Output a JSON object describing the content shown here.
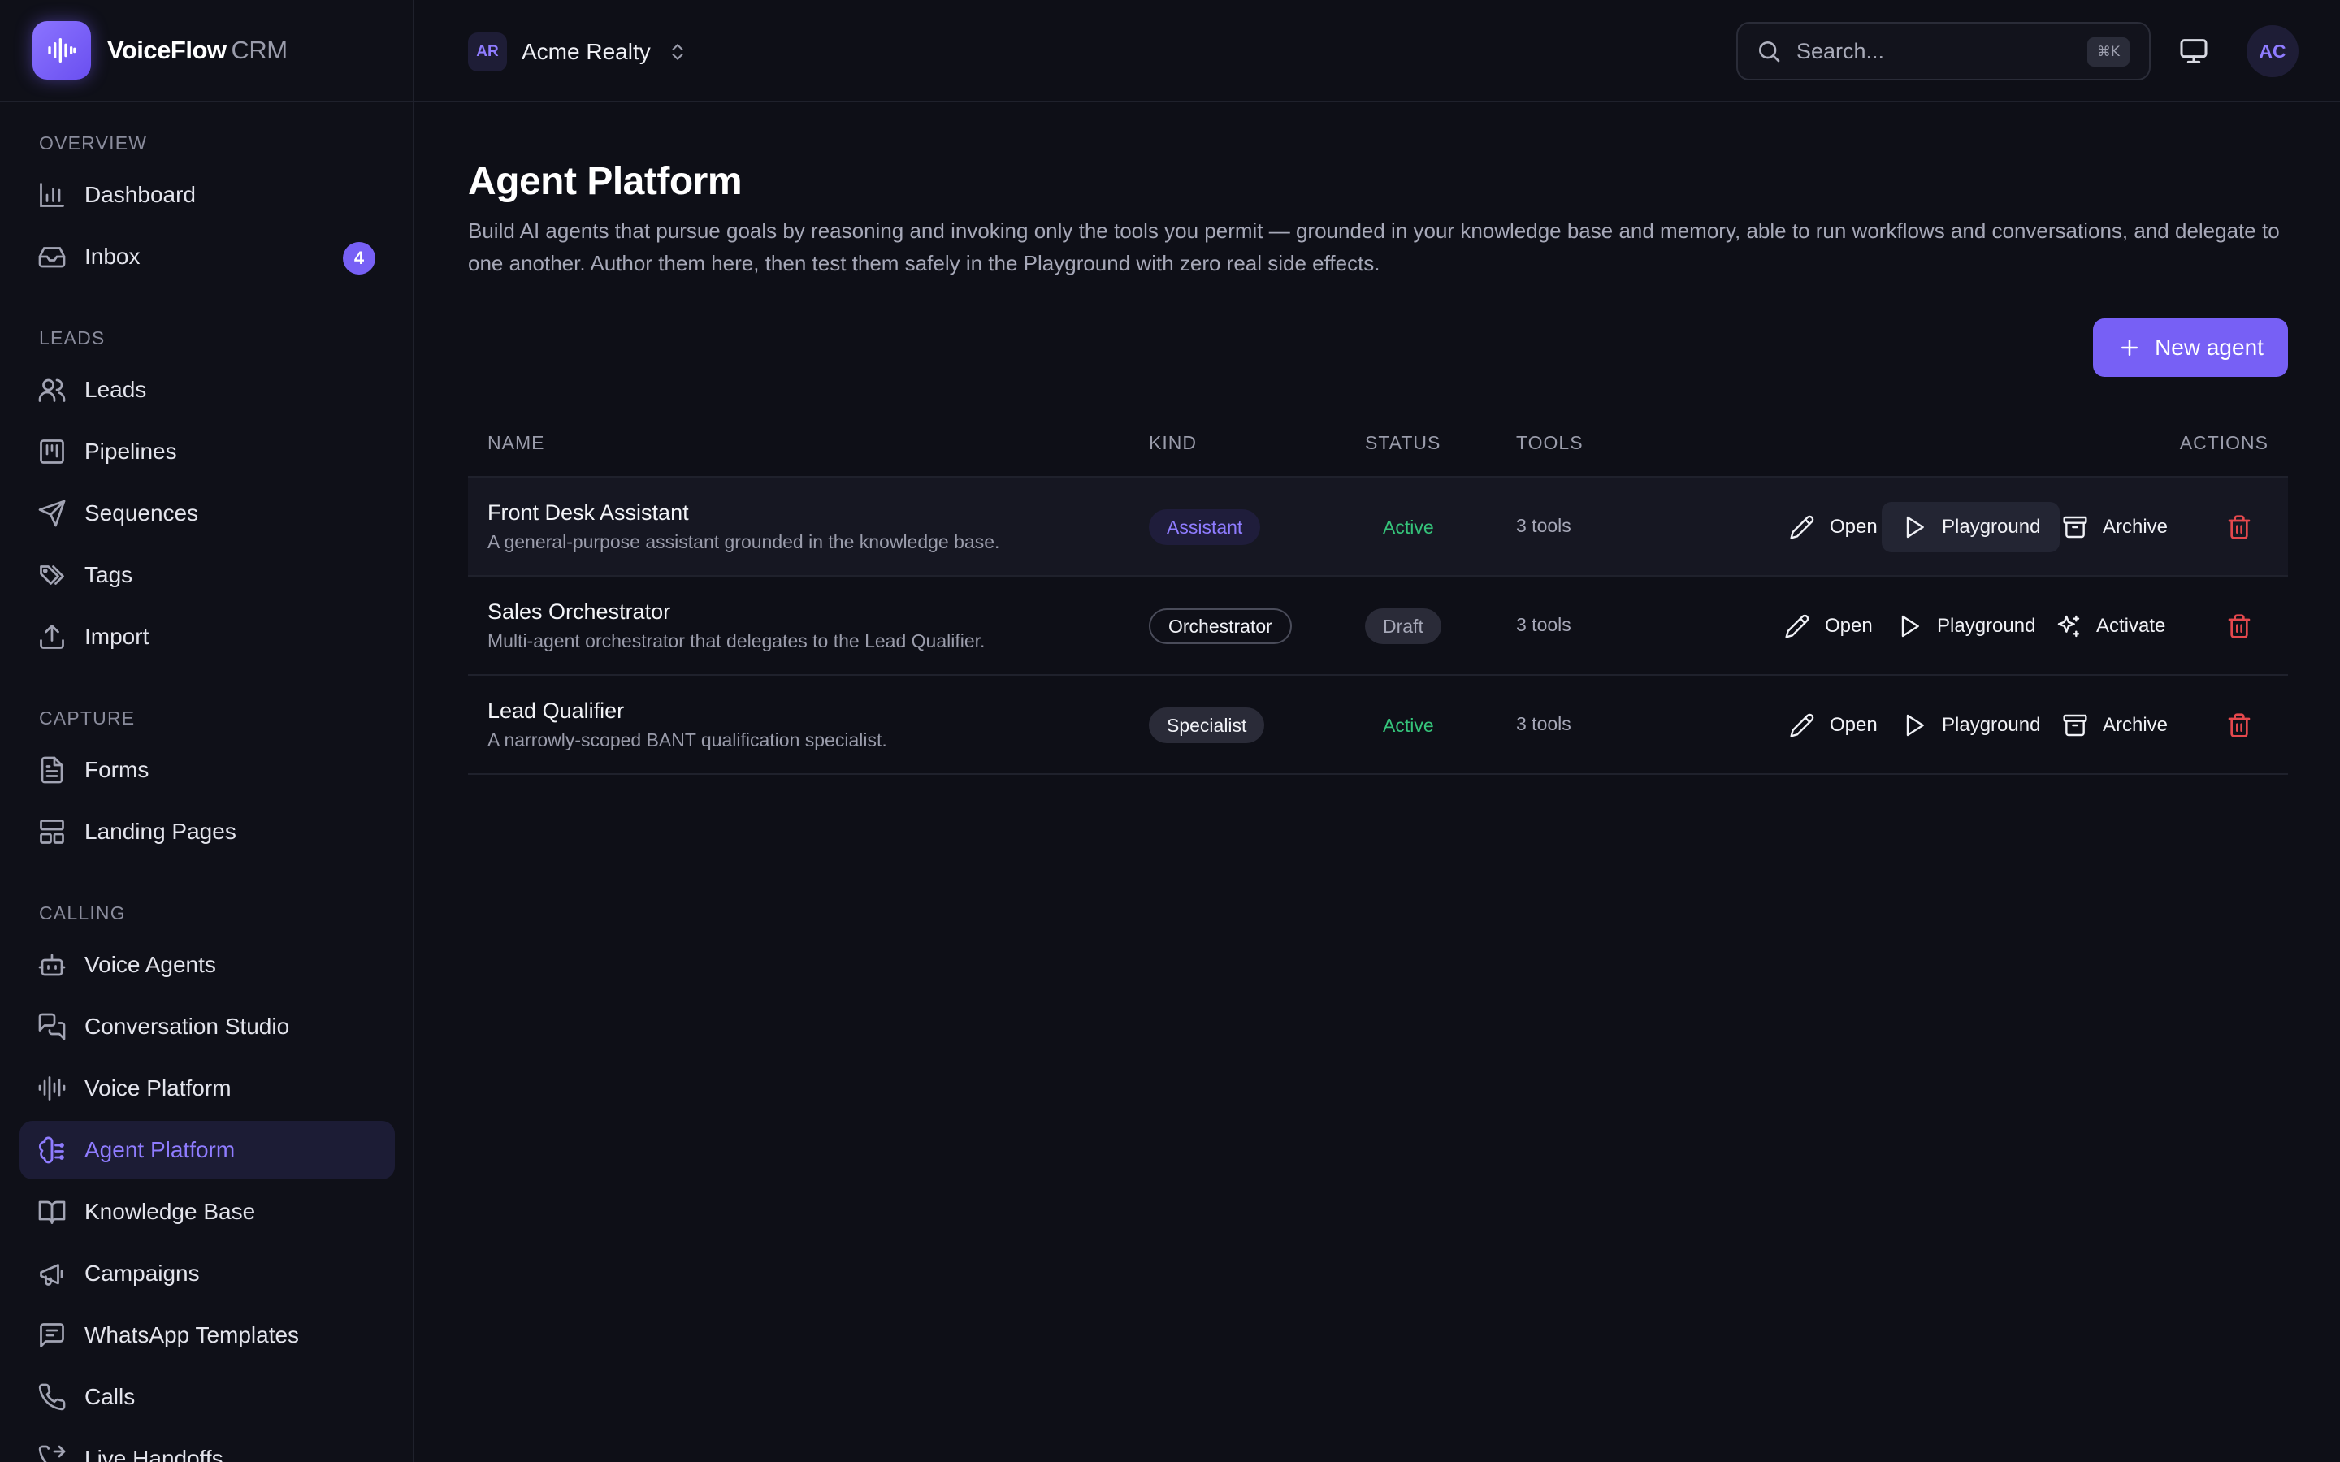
{
  "brand": {
    "name": "VoiceFlow",
    "suffix": "CRM"
  },
  "sidebar": {
    "sections": [
      {
        "title": "OVERVIEW"
      },
      {
        "title": "LEADS"
      },
      {
        "title": "CAPTURE"
      },
      {
        "title": "CALLING"
      }
    ],
    "items": [
      {
        "label": "Dashboard",
        "icon": "bar-chart-icon"
      },
      {
        "label": "Inbox",
        "icon": "inbox-icon",
        "badge": "4"
      },
      {
        "label": "Leads",
        "icon": "users-icon"
      },
      {
        "label": "Pipelines",
        "icon": "kanban-icon"
      },
      {
        "label": "Sequences",
        "icon": "send-icon"
      },
      {
        "label": "Tags",
        "icon": "tags-icon"
      },
      {
        "label": "Import",
        "icon": "upload-icon"
      },
      {
        "label": "Forms",
        "icon": "file-text-icon"
      },
      {
        "label": "Landing Pages",
        "icon": "layout-icon"
      },
      {
        "label": "Voice Agents",
        "icon": "bot-icon"
      },
      {
        "label": "Conversation Studio",
        "icon": "messages-icon"
      },
      {
        "label": "Voice Platform",
        "icon": "audio-lines-icon"
      },
      {
        "label": "Agent Platform",
        "icon": "brain-icon",
        "active": true
      },
      {
        "label": "Knowledge Base",
        "icon": "book-open-icon"
      },
      {
        "label": "Campaigns",
        "icon": "megaphone-icon"
      },
      {
        "label": "WhatsApp Templates",
        "icon": "message-square-icon"
      },
      {
        "label": "Calls",
        "icon": "phone-icon"
      },
      {
        "label": "Live Handoffs",
        "icon": "phone-forwarded-icon"
      }
    ]
  },
  "topbar": {
    "org_initials": "AR",
    "org_name": "Acme Realty",
    "search_placeholder": "Search...",
    "search_shortcut": "⌘K",
    "user_initials": "AC"
  },
  "page": {
    "title": "Agent Platform",
    "description": "Build AI agents that pursue goals by reasoning and invoking only the tools you permit — grounded in your knowledge base and memory, able to run workflows and conversations, and delegate to one another. Author them here, then test them safely in the Playground with zero real side effects.",
    "new_button": "New agent"
  },
  "table": {
    "headers": {
      "name": "NAME",
      "kind": "KIND",
      "status": "STATUS",
      "tools": "TOOLS",
      "actions": "ACTIONS"
    },
    "rows": [
      {
        "name": "Front Desk Assistant",
        "description": "A general-purpose assistant grounded in the knowledge base.",
        "kind": "Assistant",
        "status": "Active",
        "tools": "3 tools",
        "actions": {
          "open": "Open",
          "playground": "Playground",
          "toggle": "Archive"
        }
      },
      {
        "name": "Sales Orchestrator",
        "description": "Multi-agent orchestrator that delegates to the Lead Qualifier.",
        "kind": "Orchestrator",
        "status": "Draft",
        "tools": "3 tools",
        "actions": {
          "open": "Open",
          "playground": "Playground",
          "toggle": "Activate"
        }
      },
      {
        "name": "Lead Qualifier",
        "description": "A narrowly-scoped BANT qualification specialist.",
        "kind": "Specialist",
        "status": "Active",
        "tools": "3 tools",
        "actions": {
          "open": "Open",
          "playground": "Playground",
          "toggle": "Archive"
        }
      }
    ]
  },
  "colors": {
    "accent": "#7760f5",
    "background": "#0e0f17",
    "active_status": "#35c37a",
    "danger": "#e5484d"
  }
}
